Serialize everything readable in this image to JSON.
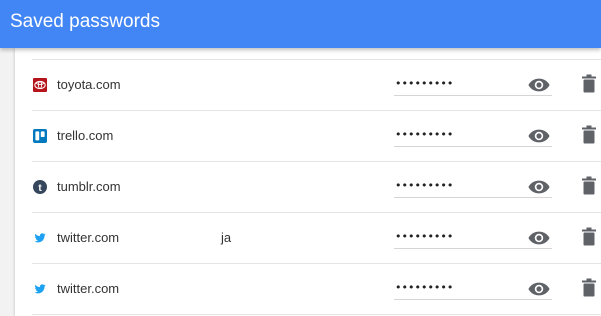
{
  "header": {
    "title": "Saved passwords"
  },
  "entries": [
    {
      "site": "toyota.com",
      "username": "",
      "password": "•••••••••",
      "favicon": "toyota-icon"
    },
    {
      "site": "trello.com",
      "username": "",
      "password": "•••••••••",
      "favicon": "trello-icon"
    },
    {
      "site": "tumblr.com",
      "username": "",
      "password": "•••••••••",
      "favicon": "tumblr-icon"
    },
    {
      "site": "twitter.com",
      "username": "ja",
      "password": "•••••••••",
      "favicon": "twitter-icon"
    },
    {
      "site": "twitter.com",
      "username": "",
      "password": "•••••••••",
      "favicon": "twitter-icon"
    }
  ],
  "icons": {
    "show_password": "eye-icon",
    "delete": "trash-icon"
  },
  "colors": {
    "header": "#4285f4",
    "toyota": "#b4141a",
    "trello": "#0079bf",
    "tumblr": "#36465d",
    "twitter": "#1da1f2",
    "icon": "#5f6368"
  }
}
